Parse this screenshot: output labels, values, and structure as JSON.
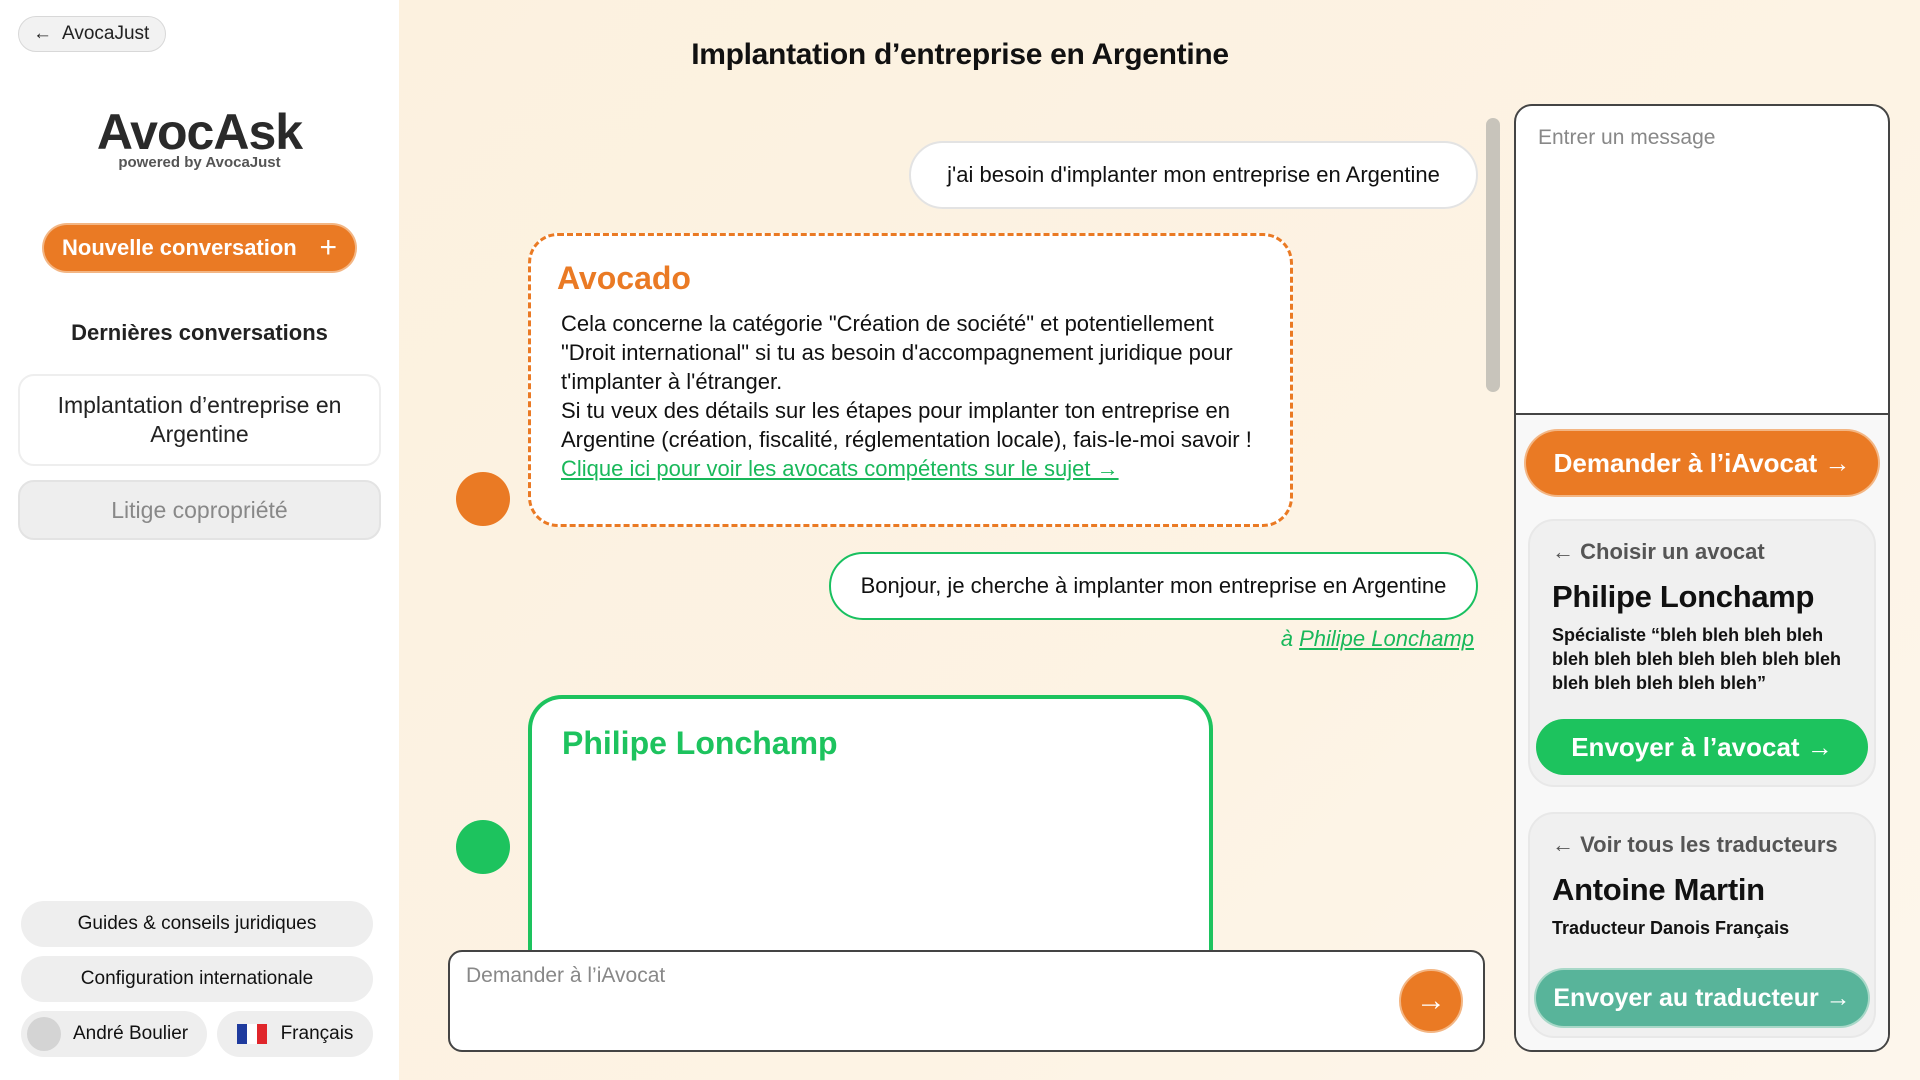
{
  "nav": {
    "back_label": "AvocaJust",
    "back_icon": "arrow-left-icon"
  },
  "brand": {
    "name": "AvocAsk",
    "powered_by": "powered by AvocaJust"
  },
  "sidebar": {
    "new_conversation": "Nouvelle conversation",
    "new_icon": "plus-icon",
    "recent_title": "Dernières conversations",
    "conversations": [
      {
        "label": "Implantation d’entreprise en Argentine",
        "active": true
      },
      {
        "label": "Litige copropriété",
        "active": false
      }
    ],
    "guides": "Guides & conseils juridiques",
    "config": "Configuration internationale",
    "user_name": "André Boulier",
    "language": "Français"
  },
  "chat": {
    "title": "Implantation d’entreprise en Argentine",
    "messages": [
      {
        "from": "user",
        "text": "j'ai besoin d'implanter mon entreprise en Argentine"
      },
      {
        "from": "bot",
        "author": "Avocado",
        "lines": [
          "Cela concerne la catégorie \"Création de société\" et potentiellement",
          "\"Droit international\" si tu as besoin d'accompagnement juridique pour",
          "t'implanter à l'étranger.",
          "Si tu veux des détails sur les étapes pour implanter ton entreprise en",
          "Argentine (création, fiscalité, réglementation locale), fais-le-moi savoir !"
        ],
        "link": "Clique ici pour voir les avocats compétents sur le sujet →"
      },
      {
        "from": "user",
        "text": "Bonjour, je cherche à implanter mon entreprise en Argentine",
        "to_prefix": "à",
        "to_name": "Philipe Lonchamp"
      },
      {
        "from": "lawyer",
        "author": "Philipe Lonchamp"
      }
    ],
    "composer_placeholder": "Demander à l’iAvocat",
    "send_icon": "arrow-right-icon"
  },
  "right_panel": {
    "message_placeholder": "Entrer un message",
    "ask_button": "Demander à l’iAvocat →",
    "lawyer_card": {
      "choose_label": "← Choisir un avocat",
      "name": "Philipe Lonchamp",
      "speciality": "Spécialiste “bleh bleh bleh bleh bleh bleh bleh bleh bleh bleh bleh bleh bleh bleh bleh bleh”",
      "send_button": "Envoyer à l’avocat →"
    },
    "translator_card": {
      "choose_label": "← Voir tous les traducteurs",
      "name": "Antoine Martin",
      "speciality": "Traducteur Danois Français",
      "send_button": "Envoyer au traducteur →"
    }
  },
  "colors": {
    "accent": "#ea7a24",
    "lawyer_green": "#1dc35e",
    "translator_teal": "#58b49a",
    "background": "#fcf1df"
  }
}
